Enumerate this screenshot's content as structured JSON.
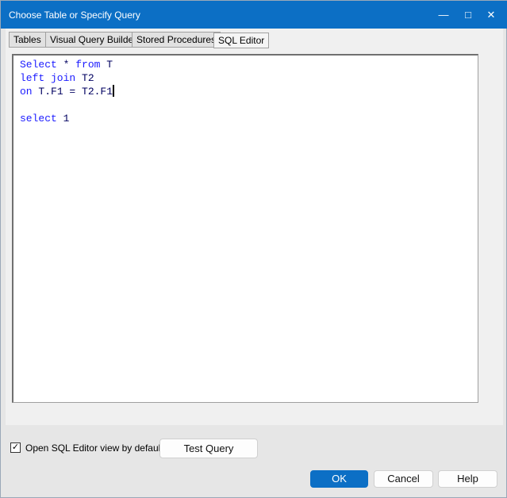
{
  "window": {
    "title": "Choose Table or Specify Query",
    "minimize": "—",
    "maximize": "□",
    "close": "✕"
  },
  "tabs": [
    "Tables",
    "Visual Query Builder",
    "Stored Procedures",
    "SQL Editor"
  ],
  "editor": {
    "lines": [
      [
        {
          "t": "Select",
          "k": true
        },
        {
          "t": " * ",
          "k": false
        },
        {
          "t": "from",
          "k": true
        },
        {
          "t": " T",
          "k": false
        }
      ],
      [
        {
          "t": "left join",
          "k": true
        },
        {
          "t": " T2",
          "k": false
        }
      ],
      [
        {
          "t": "on",
          "k": true
        },
        {
          "t": " T.F1 = T2.F1",
          "k": false
        }
      ],
      [],
      [
        {
          "t": "select",
          "k": true
        },
        {
          "t": " 1",
          "k": false
        }
      ]
    ]
  },
  "footer": {
    "checkbox_label": "Open SQL Editor view by default",
    "checked": true,
    "check_mark": "✓",
    "test_query": "Test Query",
    "ok": "OK",
    "cancel": "Cancel",
    "help": "Help"
  }
}
